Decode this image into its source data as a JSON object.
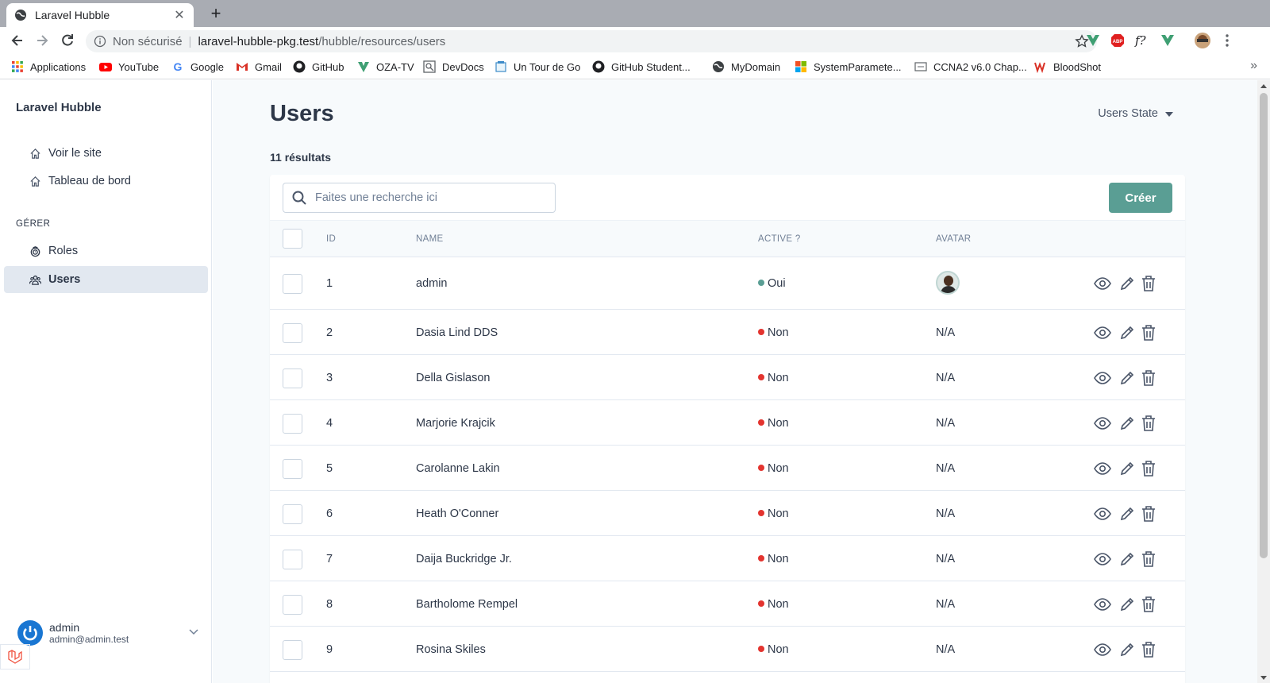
{
  "browser": {
    "tab_title": "Laravel Hubble",
    "new_tab": "+",
    "tab_close": "✕",
    "url_insecure": "Non sécurisé",
    "url_host": "laravel-hubble-pkg.test",
    "url_path": "/hubble/resources/users",
    "bookmarks": [
      {
        "label": "Applications",
        "icon": "apps-grid-icon"
      },
      {
        "label": "YouTube",
        "icon": "youtube-icon"
      },
      {
        "label": "Google",
        "icon": "google-icon"
      },
      {
        "label": "Gmail",
        "icon": "gmail-icon"
      },
      {
        "label": "GitHub",
        "icon": "github-icon"
      },
      {
        "label": "OZA-TV",
        "icon": "oza-icon"
      },
      {
        "label": "DevDocs",
        "icon": "devdocs-icon"
      },
      {
        "label": "Un Tour de Go",
        "icon": "go-icon"
      },
      {
        "label": "GitHub Student...",
        "icon": "github-icon"
      },
      {
        "label": "MyDomain",
        "icon": "globe-icon"
      },
      {
        "label": "SystemParamete...",
        "icon": "microsoft-icon"
      },
      {
        "label": "CCNA2 v6.0 Chap...",
        "icon": "ccna-icon"
      },
      {
        "label": "BloodShot",
        "icon": "bloodshot-icon"
      }
    ],
    "more": "»",
    "ext_f": "f?"
  },
  "sidebar": {
    "brand": "Laravel Hubble",
    "items": [
      {
        "label": "Voir le site",
        "icon": "home-icon"
      },
      {
        "label": "Tableau de bord",
        "icon": "home-icon"
      }
    ],
    "section_label": "GÉRER",
    "manage_items": [
      {
        "label": "Roles",
        "icon": "fingerprint-icon"
      },
      {
        "label": "Users",
        "icon": "users-icon",
        "active": true
      }
    ],
    "user": {
      "name": "admin",
      "email": "admin@admin.test"
    }
  },
  "main": {
    "title": "Users",
    "state_dropdown": "Users State",
    "results_count": "11 résultats",
    "search_placeholder": "Faites une recherche ici",
    "create_label": "Créer",
    "columns": {
      "id": "ID",
      "name": "NAME",
      "active": "ACTIVE ?",
      "avatar": "AVATAR"
    },
    "rows": [
      {
        "id": "1",
        "name": "admin",
        "active": "Oui",
        "active_color": "#5a9e94",
        "avatar": "image"
      },
      {
        "id": "2",
        "name": "Dasia Lind DDS",
        "active": "Non",
        "active_color": "#e3342f",
        "avatar": "N/A"
      },
      {
        "id": "3",
        "name": "Della Gislason",
        "active": "Non",
        "active_color": "#e3342f",
        "avatar": "N/A"
      },
      {
        "id": "4",
        "name": "Marjorie Krajcik",
        "active": "Non",
        "active_color": "#e3342f",
        "avatar": "N/A"
      },
      {
        "id": "5",
        "name": "Carolanne Lakin",
        "active": "Non",
        "active_color": "#e3342f",
        "avatar": "N/A"
      },
      {
        "id": "6",
        "name": "Heath O'Conner",
        "active": "Non",
        "active_color": "#e3342f",
        "avatar": "N/A"
      },
      {
        "id": "7",
        "name": "Daija Buckridge Jr.",
        "active": "Non",
        "active_color": "#e3342f",
        "avatar": "N/A"
      },
      {
        "id": "8",
        "name": "Bartholome Rempel",
        "active": "Non",
        "active_color": "#e3342f",
        "avatar": "N/A"
      },
      {
        "id": "9",
        "name": "Rosina Skiles",
        "active": "Non",
        "active_color": "#e3342f",
        "avatar": "N/A"
      }
    ]
  },
  "colors": {
    "accent": "#5a9e94",
    "inactive": "#e3342f",
    "active_nav_bg": "#e2e8f0"
  }
}
